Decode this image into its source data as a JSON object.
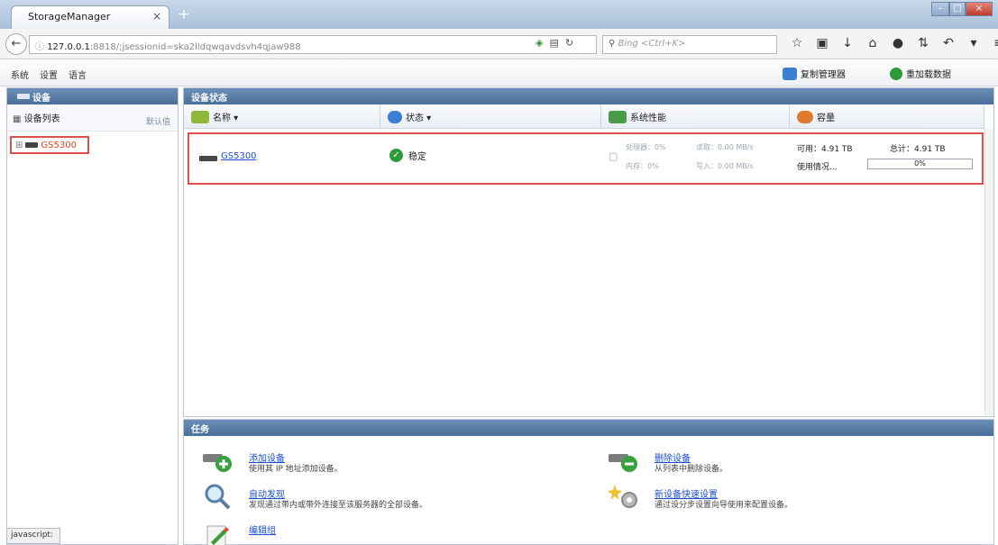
{
  "browser": {
    "tab_title": "StorageManager",
    "tab_close": "×",
    "new_tab": "+",
    "url_host": "127.0.0.1",
    "url_rest": ":8818/;jsessionid=ska2lldqwqavdsvh4qjaw988",
    "search_placeholder": "Bing <Ctrl+K>",
    "window_min": "–",
    "window_max": "□",
    "window_close": "×",
    "toolbar_icons": [
      "star-icon",
      "bookmarks-icon",
      "download-icon",
      "home-icon",
      "chat-icon",
      "sync-icon",
      "undo-icon",
      "more-icon",
      "menu-icon"
    ]
  },
  "menu": {
    "items": [
      "系统",
      "设置",
      "语言"
    ],
    "actions": [
      {
        "label": "复制管理器",
        "icon": "copy-manager-icon",
        "color": "#3a7fd4"
      },
      {
        "label": "重加载数据",
        "icon": "reload-icon",
        "color": "#2e9a3a"
      }
    ]
  },
  "left_panel": {
    "header": "设备",
    "device_list_label": "设备列表",
    "default_label": "默认值",
    "tree_node": "GS5300"
  },
  "main_panel": {
    "header": "设备状态",
    "columns": [
      {
        "label": "名称 ▾",
        "icon": "name-icon",
        "color": "#8fb83a"
      },
      {
        "label": "状态 ▾",
        "icon": "status-icon",
        "color": "#3a7fd4"
      },
      {
        "label": "系统性能",
        "icon": "performance-icon",
        "color": "#4a9a4a"
      },
      {
        "label": "容量",
        "icon": "capacity-icon",
        "color": "#e07a2e"
      }
    ],
    "device": {
      "name": "GS5300",
      "status": "稳定",
      "cpu": "处理器：0%",
      "read": "读取：0.00 MB/s",
      "memory": "内存：0%",
      "write": "写入：0.00 MB/s",
      "available": "可用：4.91 TB",
      "total": "总计：4.91 TB",
      "usage_label": "使用情况...",
      "usage_text": "0%",
      "usage_fraction": 0
    }
  },
  "task_panel": {
    "header": "任务",
    "tasks": [
      {
        "title": "添加设备",
        "desc": "使用其 IP 地址添加设备。",
        "icon": "add-device-icon"
      },
      {
        "title": "删除设备",
        "desc": "从列表中删除设备。",
        "icon": "remove-device-icon"
      },
      {
        "title": "自动发现",
        "desc": "发现通过带内或带外连接至该服务器的全部设备。",
        "icon": "auto-discover-icon"
      },
      {
        "title": "新设备快速设置",
        "desc": "通过设分步设置向导使用来配置设备。",
        "icon": "quick-setup-icon"
      },
      {
        "title": "编辑组",
        "desc": "",
        "icon": "edit-group-icon"
      }
    ]
  },
  "status_bar": "javascript:"
}
